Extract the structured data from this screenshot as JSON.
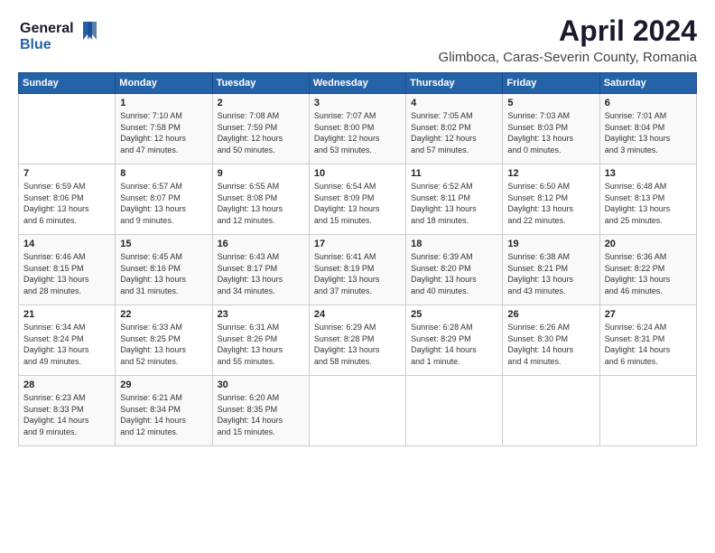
{
  "logo": {
    "line1": "General",
    "line2": "Blue"
  },
  "title": "April 2024",
  "subtitle": "Glimboca, Caras-Severin County, Romania",
  "days_header": [
    "Sunday",
    "Monday",
    "Tuesday",
    "Wednesday",
    "Thursday",
    "Friday",
    "Saturday"
  ],
  "weeks": [
    [
      {
        "day": "",
        "info": ""
      },
      {
        "day": "1",
        "info": "Sunrise: 7:10 AM\nSunset: 7:58 PM\nDaylight: 12 hours\nand 47 minutes."
      },
      {
        "day": "2",
        "info": "Sunrise: 7:08 AM\nSunset: 7:59 PM\nDaylight: 12 hours\nand 50 minutes."
      },
      {
        "day": "3",
        "info": "Sunrise: 7:07 AM\nSunset: 8:00 PM\nDaylight: 12 hours\nand 53 minutes."
      },
      {
        "day": "4",
        "info": "Sunrise: 7:05 AM\nSunset: 8:02 PM\nDaylight: 12 hours\nand 57 minutes."
      },
      {
        "day": "5",
        "info": "Sunrise: 7:03 AM\nSunset: 8:03 PM\nDaylight: 13 hours\nand 0 minutes."
      },
      {
        "day": "6",
        "info": "Sunrise: 7:01 AM\nSunset: 8:04 PM\nDaylight: 13 hours\nand 3 minutes."
      }
    ],
    [
      {
        "day": "7",
        "info": "Sunrise: 6:59 AM\nSunset: 8:06 PM\nDaylight: 13 hours\nand 6 minutes."
      },
      {
        "day": "8",
        "info": "Sunrise: 6:57 AM\nSunset: 8:07 PM\nDaylight: 13 hours\nand 9 minutes."
      },
      {
        "day": "9",
        "info": "Sunrise: 6:55 AM\nSunset: 8:08 PM\nDaylight: 13 hours\nand 12 minutes."
      },
      {
        "day": "10",
        "info": "Sunrise: 6:54 AM\nSunset: 8:09 PM\nDaylight: 13 hours\nand 15 minutes."
      },
      {
        "day": "11",
        "info": "Sunrise: 6:52 AM\nSunset: 8:11 PM\nDaylight: 13 hours\nand 18 minutes."
      },
      {
        "day": "12",
        "info": "Sunrise: 6:50 AM\nSunset: 8:12 PM\nDaylight: 13 hours\nand 22 minutes."
      },
      {
        "day": "13",
        "info": "Sunrise: 6:48 AM\nSunset: 8:13 PM\nDaylight: 13 hours\nand 25 minutes."
      }
    ],
    [
      {
        "day": "14",
        "info": "Sunrise: 6:46 AM\nSunset: 8:15 PM\nDaylight: 13 hours\nand 28 minutes."
      },
      {
        "day": "15",
        "info": "Sunrise: 6:45 AM\nSunset: 8:16 PM\nDaylight: 13 hours\nand 31 minutes."
      },
      {
        "day": "16",
        "info": "Sunrise: 6:43 AM\nSunset: 8:17 PM\nDaylight: 13 hours\nand 34 minutes."
      },
      {
        "day": "17",
        "info": "Sunrise: 6:41 AM\nSunset: 8:19 PM\nDaylight: 13 hours\nand 37 minutes."
      },
      {
        "day": "18",
        "info": "Sunrise: 6:39 AM\nSunset: 8:20 PM\nDaylight: 13 hours\nand 40 minutes."
      },
      {
        "day": "19",
        "info": "Sunrise: 6:38 AM\nSunset: 8:21 PM\nDaylight: 13 hours\nand 43 minutes."
      },
      {
        "day": "20",
        "info": "Sunrise: 6:36 AM\nSunset: 8:22 PM\nDaylight: 13 hours\nand 46 minutes."
      }
    ],
    [
      {
        "day": "21",
        "info": "Sunrise: 6:34 AM\nSunset: 8:24 PM\nDaylight: 13 hours\nand 49 minutes."
      },
      {
        "day": "22",
        "info": "Sunrise: 6:33 AM\nSunset: 8:25 PM\nDaylight: 13 hours\nand 52 minutes."
      },
      {
        "day": "23",
        "info": "Sunrise: 6:31 AM\nSunset: 8:26 PM\nDaylight: 13 hours\nand 55 minutes."
      },
      {
        "day": "24",
        "info": "Sunrise: 6:29 AM\nSunset: 8:28 PM\nDaylight: 13 hours\nand 58 minutes."
      },
      {
        "day": "25",
        "info": "Sunrise: 6:28 AM\nSunset: 8:29 PM\nDaylight: 14 hours\nand 1 minute."
      },
      {
        "day": "26",
        "info": "Sunrise: 6:26 AM\nSunset: 8:30 PM\nDaylight: 14 hours\nand 4 minutes."
      },
      {
        "day": "27",
        "info": "Sunrise: 6:24 AM\nSunset: 8:31 PM\nDaylight: 14 hours\nand 6 minutes."
      }
    ],
    [
      {
        "day": "28",
        "info": "Sunrise: 6:23 AM\nSunset: 8:33 PM\nDaylight: 14 hours\nand 9 minutes."
      },
      {
        "day": "29",
        "info": "Sunrise: 6:21 AM\nSunset: 8:34 PM\nDaylight: 14 hours\nand 12 minutes."
      },
      {
        "day": "30",
        "info": "Sunrise: 6:20 AM\nSunset: 8:35 PM\nDaylight: 14 hours\nand 15 minutes."
      },
      {
        "day": "",
        "info": ""
      },
      {
        "day": "",
        "info": ""
      },
      {
        "day": "",
        "info": ""
      },
      {
        "day": "",
        "info": ""
      }
    ]
  ]
}
